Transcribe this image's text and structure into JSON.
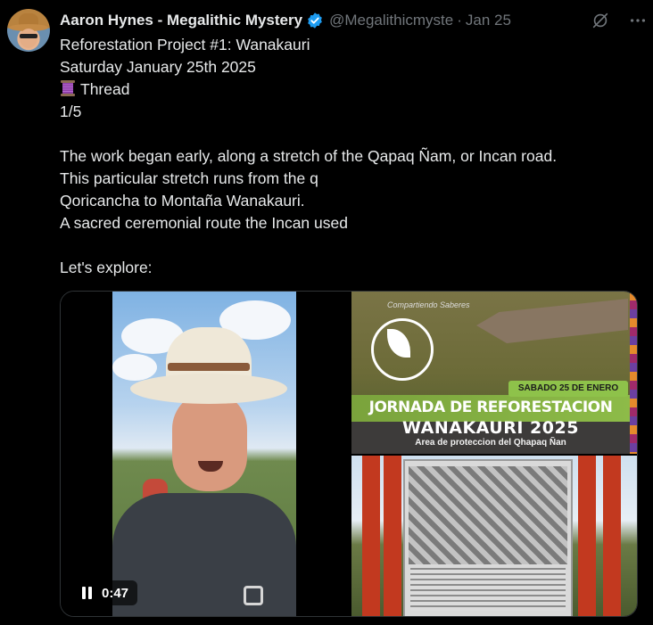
{
  "author": {
    "name": "Aaron Hynes - Megalithic Mystery",
    "handle": "@Megalithicmyste",
    "separator": "·",
    "date": "Jan 25",
    "verified": true,
    "avatar_icon": "avatar-photo"
  },
  "actions": {
    "grok_icon": "grok-icon",
    "more_icon": "more-options-icon"
  },
  "tweet": {
    "line1": "Reforestation Project #1: Wanakauri",
    "line2": "Saturday January 25th 2025",
    "line3": "Thread",
    "line3_emoji": "spool-of-thread-emoji",
    "line4": "1/5",
    "line5": "",
    "line6": "The work began early, along a stretch of the Qapaq Ñam, or Incan road.",
    "line7": "This particular stretch runs from the q",
    "line8": "Qoricancha to Montaña Wanakauri.",
    "line9": "A sacred ceremonial route the Incan used",
    "line10": "",
    "line11": "Let's explore:"
  },
  "media": {
    "video": {
      "time": "0:47",
      "state_icon": "pause-icon"
    },
    "image1": {
      "corner_text": "Compartiendo Saberes",
      "tag": "SABADO 25 DE ENERO",
      "title_line1": "JORNADA DE REFORESTACION",
      "title_line2": "WANAKAURI 2025",
      "subtitle": "Area de proteccion del Qhapaq Ñan"
    },
    "image2": {
      "description_icon": "info-sign-board"
    }
  },
  "colors": {
    "background": "#000000",
    "text": "#e7e9ea",
    "muted": "#71767b",
    "verified": "#1d9bf0",
    "border": "#2f3336"
  }
}
